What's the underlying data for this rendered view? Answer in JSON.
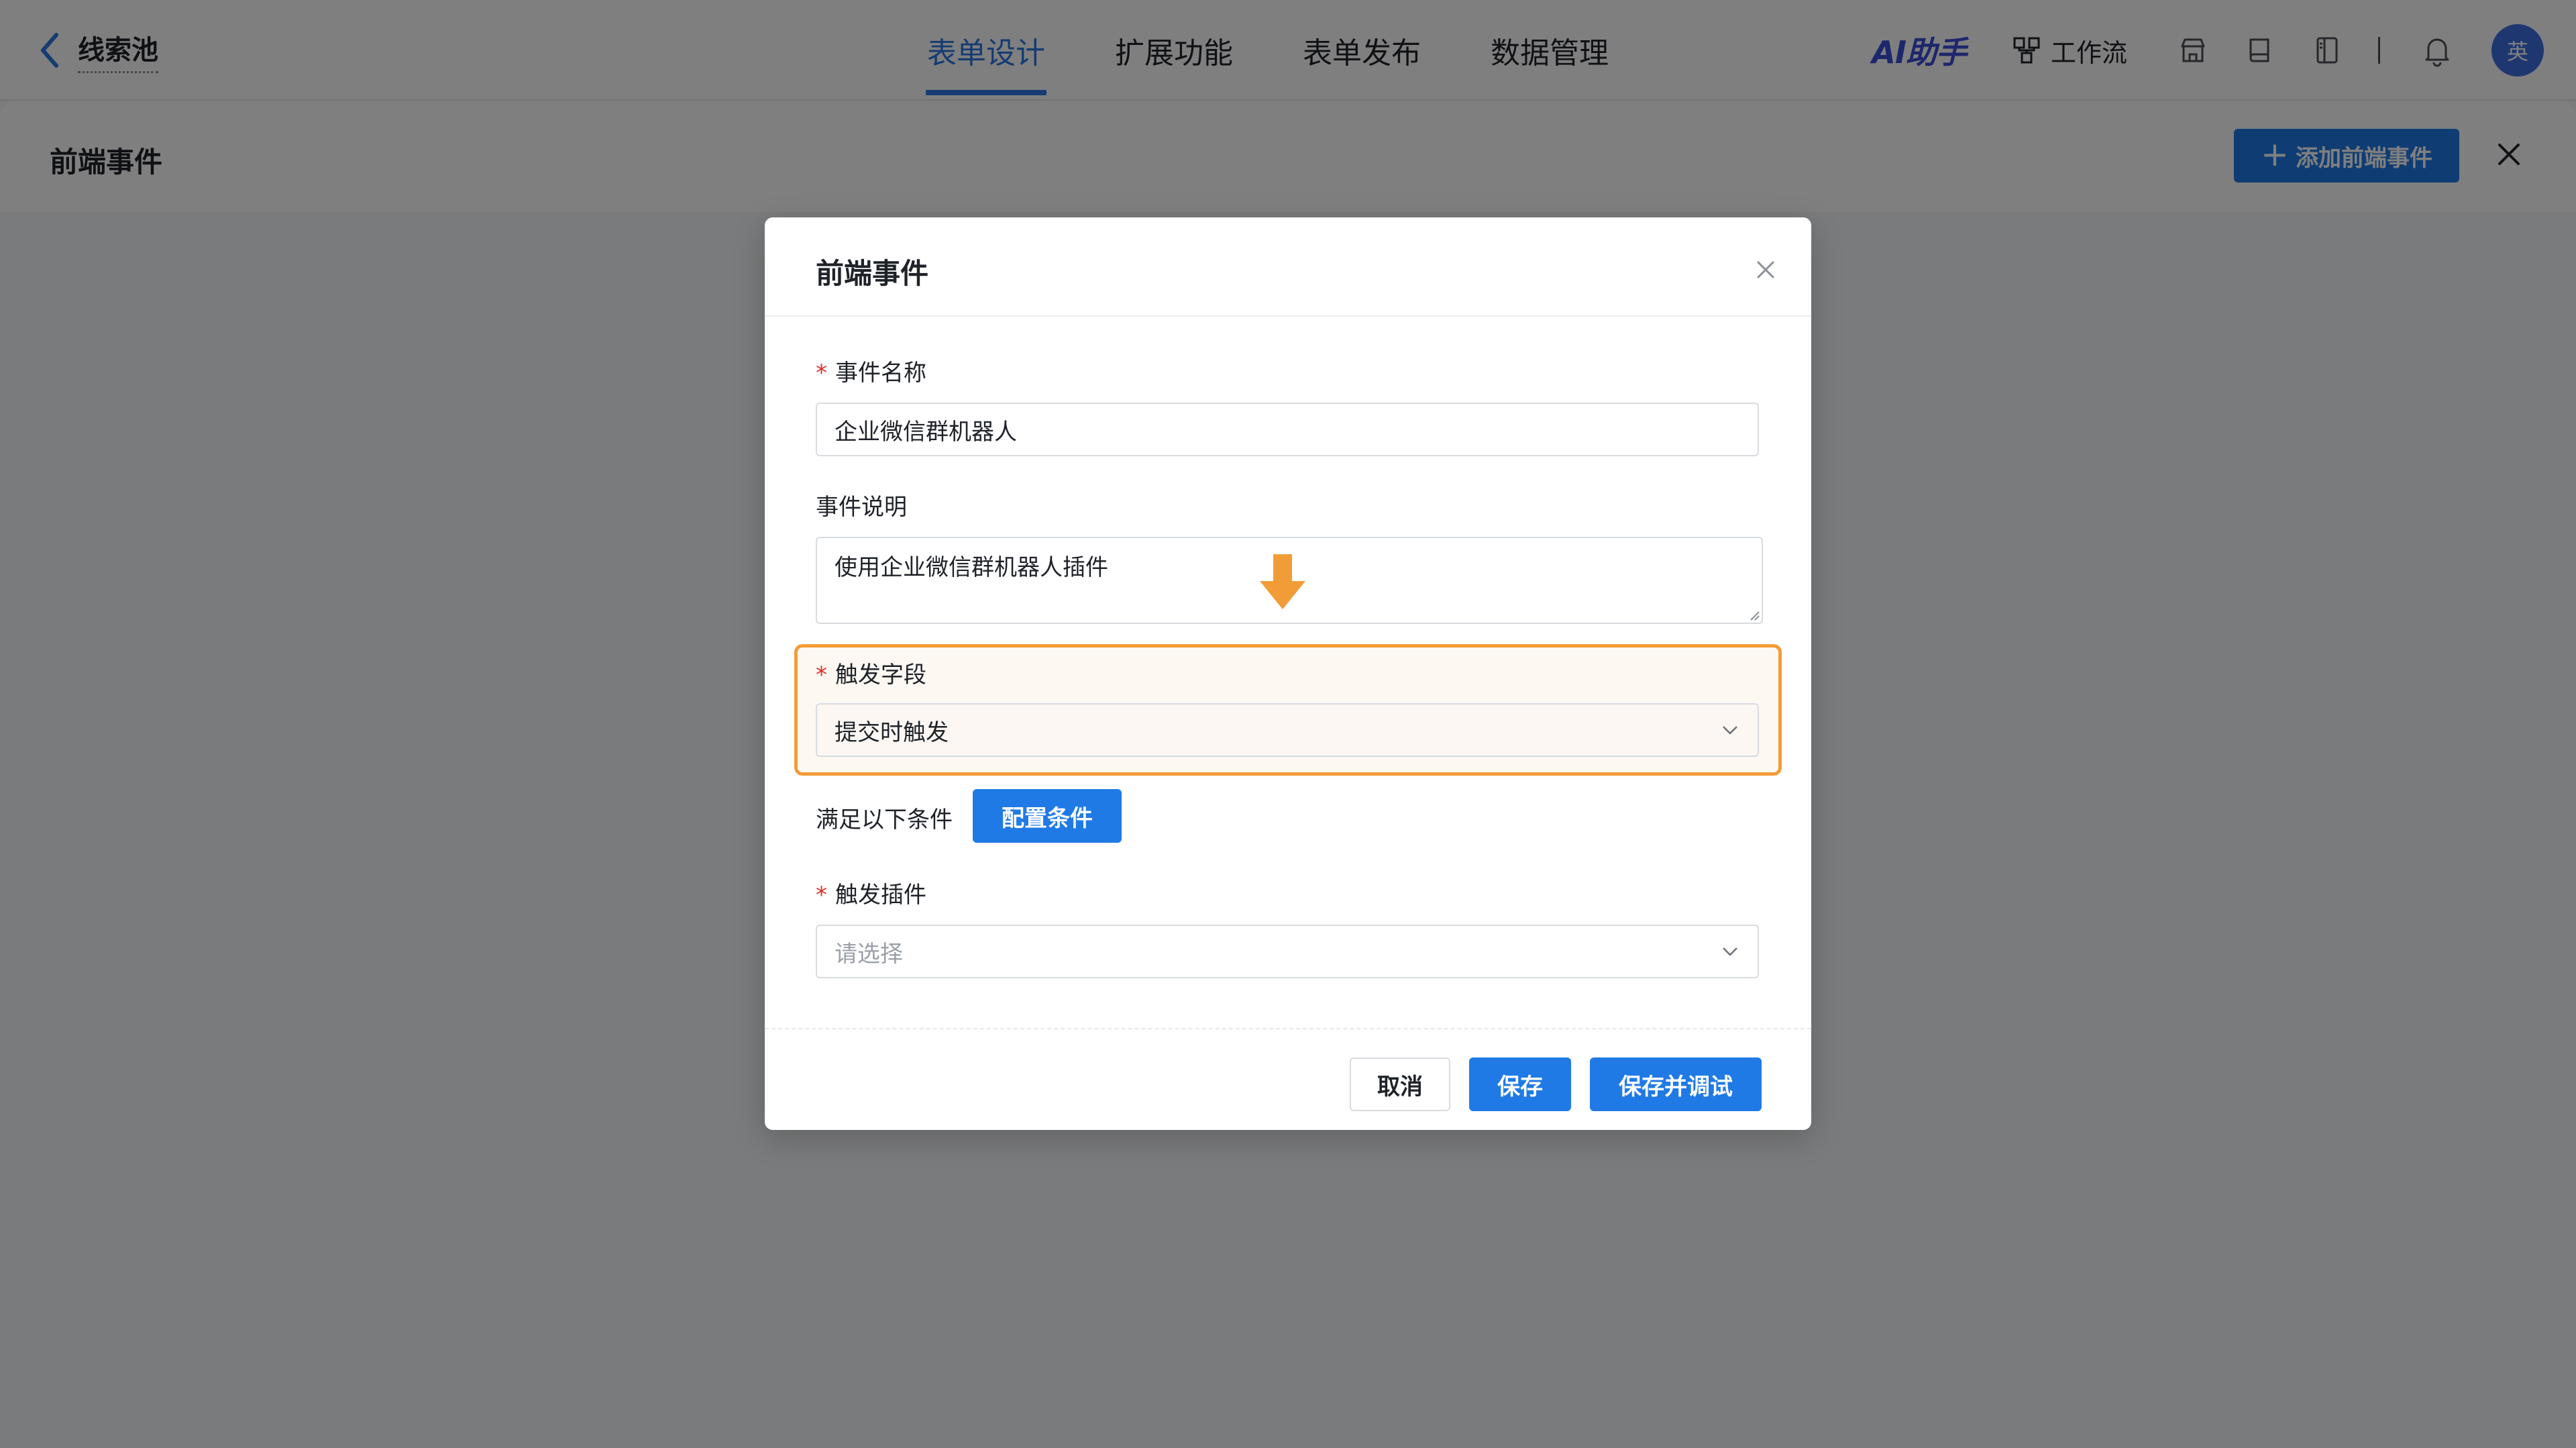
{
  "topbar": {
    "back_label": "线索池",
    "tabs": [
      {
        "label": "表单设计",
        "active": true
      },
      {
        "label": "扩展功能",
        "active": false
      },
      {
        "label": "表单发布",
        "active": false
      },
      {
        "label": "数据管理",
        "active": false
      }
    ],
    "ai_assistant": "AI助手",
    "workflow_label": "工作流",
    "avatar_text": "英",
    "accent_color": "#2b77e5"
  },
  "drawer": {
    "title": "前端事件",
    "add_button": "添加前端事件"
  },
  "modal": {
    "title": "前端事件",
    "fields": {
      "event_name": {
        "label": "事件名称",
        "required": true,
        "value": "企业微信群机器人"
      },
      "event_desc": {
        "label": "事件说明",
        "required": false,
        "value": "使用企业微信群机器人插件"
      },
      "trigger_field": {
        "label": "触发字段",
        "required": true,
        "value": "提交时触发"
      },
      "condition": {
        "label": "满足以下条件",
        "button": "配置条件"
      },
      "trigger_plugin": {
        "label": "触发插件",
        "required": true,
        "placeholder": "请选择"
      }
    },
    "buttons": {
      "cancel": "取消",
      "save": "保存",
      "save_debug": "保存并调试"
    },
    "highlight_color": "#f29c38"
  }
}
